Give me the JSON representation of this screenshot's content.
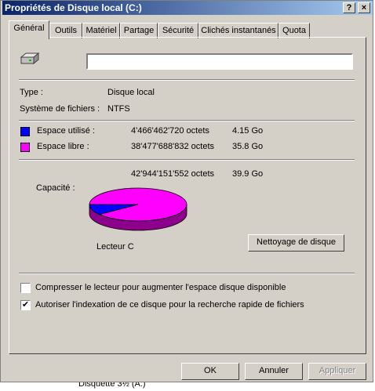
{
  "window": {
    "title": "Propriétés de Disque local (C:)",
    "help_glyph": "?",
    "close_glyph": "×"
  },
  "tabs": [
    {
      "label": "Général",
      "active": true
    },
    {
      "label": "Outils"
    },
    {
      "label": "Matériel"
    },
    {
      "label": "Partage"
    },
    {
      "label": "Sécurité"
    },
    {
      "label": "Clichés instantanés"
    },
    {
      "label": "Quota"
    }
  ],
  "general": {
    "drive_icon": "hard-drive-icon",
    "name_value": "",
    "type_label": "Type :",
    "type_value": "Disque local",
    "fs_label": "Système de fichiers :",
    "fs_value": "NTFS",
    "used": {
      "label": "Espace utilisé :",
      "bytes": "4'466'462'720 octets",
      "size": "4.15 Go",
      "color": "#0000ff"
    },
    "free": {
      "label": "Espace libre :",
      "bytes": "38'477'688'832 octets",
      "size": "35.8 Go",
      "color": "#ff00ff"
    },
    "capacity": {
      "label": "Capacité :",
      "bytes": "42'944'151'552 octets",
      "size": "39.9 Go"
    },
    "drive_label": "Lecteur C",
    "cleanup_button": "Nettoyage de disque",
    "compress_label": "Compresser le lecteur pour augmenter l'espace disque disponible",
    "compress_checked": false,
    "index_label": "Autoriser l'indexation de ce disque pour la recherche rapide de fichiers",
    "index_checked": true,
    "check_glyph": "✔"
  },
  "buttons": {
    "ok": "OK",
    "cancel": "Annuler",
    "apply": "Appliquer"
  },
  "taskbar_fragment": "Disquette 3½ (A:)",
  "chart_data": {
    "type": "pie",
    "categories": [
      "Espace utilisé",
      "Espace libre"
    ],
    "values": [
      4466462720,
      38477688832
    ],
    "colors": [
      "#0000ff",
      "#ff00ff"
    ]
  }
}
